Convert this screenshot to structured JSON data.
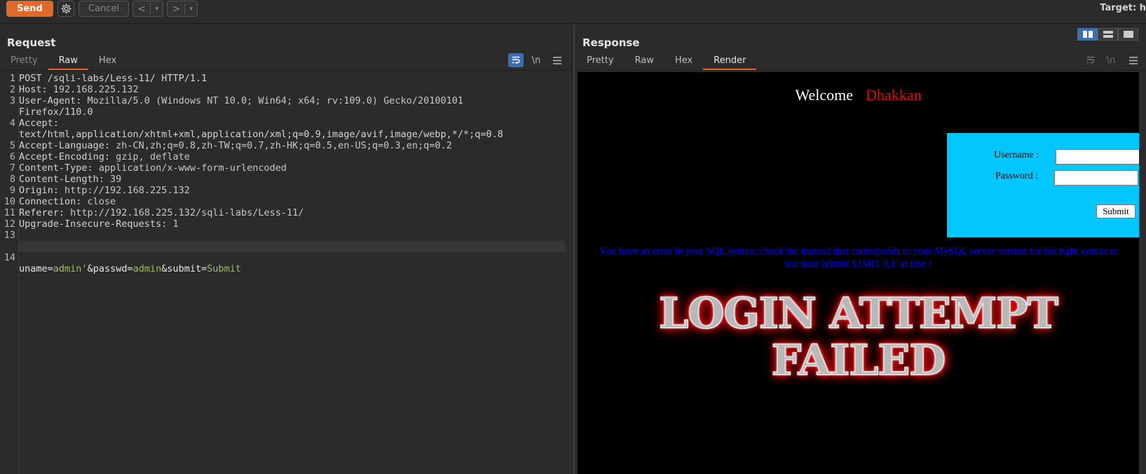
{
  "toolbar": {
    "send_label": "Send",
    "cancel_label": "Cancel",
    "back_glyph": "<",
    "forward_glyph": ">",
    "dropdown_glyph": "▾",
    "target_label": "Target: h"
  },
  "request": {
    "title": "Request",
    "tabs": [
      "Pretty",
      "Raw",
      "Hex"
    ],
    "active_tab": "Raw",
    "tools": {
      "newline_label": "\\n"
    },
    "lines": [
      {
        "n": "1",
        "text": "POST /sqli-labs/Less-11/ HTTP/1.1"
      },
      {
        "n": "2",
        "key": "Host:",
        "val": " 192.168.225.132"
      },
      {
        "n": "3",
        "key": "User-Agent:",
        "val": " Mozilla/5.0 (Windows NT 10.0; Win64; x64; rv:109.0) Gecko/20100101"
      },
      {
        "n": "",
        "text": "Firefox/110.0"
      },
      {
        "n": "4",
        "key": "Accept:",
        "val": ""
      },
      {
        "n": "",
        "text": "text/html,application/xhtml+xml,application/xml;q=0.9,image/avif,image/webp,*/*;q=0.8"
      },
      {
        "n": "5",
        "key": "Accept-Language:",
        "val": " zh-CN,zh;q=0.8,zh-TW;q=0.7,zh-HK;q=0.5,en-US;q=0.3,en;q=0.2"
      },
      {
        "n": "6",
        "key": "Accept-Encoding:",
        "val": " gzip, deflate"
      },
      {
        "n": "7",
        "key": "Content-Type:",
        "val": " application/x-www-form-urlencoded"
      },
      {
        "n": "8",
        "key": "Content-Length:",
        "val": " 39"
      },
      {
        "n": "9",
        "key": "Origin:",
        "val": " http://192.168.225.132"
      },
      {
        "n": "10",
        "key": "Connection:",
        "val": " close"
      },
      {
        "n": "11",
        "key": "Referer:",
        "val": " http://192.168.225.132/sqli-labs/Less-11/"
      },
      {
        "n": "12",
        "key": "Upgrade-Insecure-Requests:",
        "val": " 1"
      },
      {
        "n": "13",
        "text": ""
      }
    ],
    "body_line": {
      "n": "14",
      "parts": [
        {
          "t": "uname",
          "c": "name"
        },
        {
          "t": "=",
          "c": "name"
        },
        {
          "t": "admin'",
          "c": "val"
        },
        {
          "t": "&passwd",
          "c": "name"
        },
        {
          "t": "=",
          "c": "name"
        },
        {
          "t": "admin",
          "c": "val"
        },
        {
          "t": "&submit",
          "c": "name"
        },
        {
          "t": "=",
          "c": "name"
        },
        {
          "t": "Submit",
          "c": "val"
        }
      ]
    }
  },
  "response": {
    "title": "Response",
    "tabs": [
      "Pretty",
      "Raw",
      "Hex",
      "Render"
    ],
    "active_tab": "Render",
    "render": {
      "welcome": "Welcome",
      "name": "Dhakkan",
      "username_label": "Username :",
      "password_label": "Password :",
      "submit_label": "Submit",
      "sql_error": "You have an error in your SQL syntax; check the manual that corresponds to your MySQL server version for the right syntax to use near 'admin' LIMIT 0,1' at line 1",
      "banner_line1": "LOGIN ATTEMPT",
      "banner_line2": "FAILED"
    }
  },
  "colors": {
    "accent": "#e2692c",
    "blue_toggle": "#3c6eb4",
    "form_bg": "#00c8ff",
    "error_text": "#0000ff",
    "name_red": "#e00000"
  }
}
